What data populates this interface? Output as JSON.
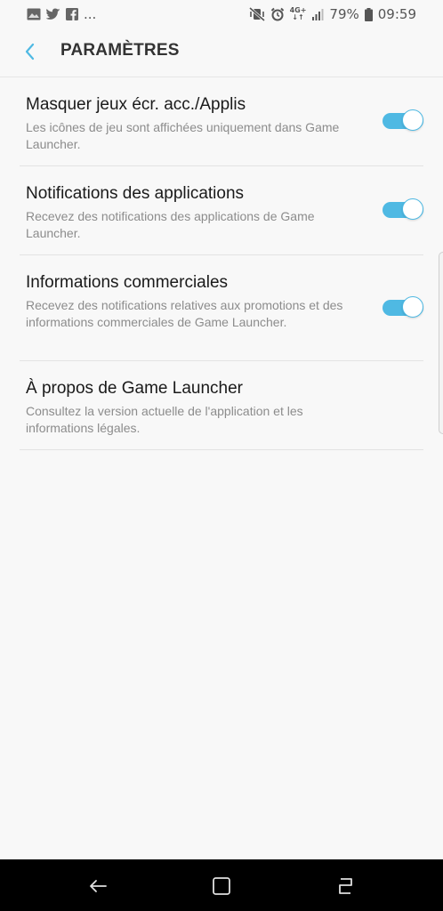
{
  "status_bar": {
    "notification_icons": [
      "image-icon",
      "twitter-icon",
      "facebook-icon"
    ],
    "more_indicator": "...",
    "network_type": "4G+",
    "battery_percent": "79%",
    "time": "09:59"
  },
  "app_bar": {
    "title": "PARAMÈTRES"
  },
  "settings": [
    {
      "title": "Masquer jeux écr. acc./Applis",
      "summary": "Les icônes de jeu sont affichées uniquement dans Game Launcher.",
      "toggle_on": true
    },
    {
      "title": "Notifications des applications",
      "summary": "Recevez des notifications des applications de Game Launcher.",
      "toggle_on": true
    },
    {
      "title": "Informations commerciales",
      "summary": "Recevez des notifications relatives aux promotions et des informations commerciales de Game Launcher.",
      "toggle_on": true
    },
    {
      "title": "À propos de Game Launcher",
      "summary": "Consultez la version actuelle de l'application et les informations légales."
    }
  ],
  "colors": {
    "accent": "#4fb9e3",
    "background": "#f8f8f8",
    "nav_bar": "#000000"
  }
}
